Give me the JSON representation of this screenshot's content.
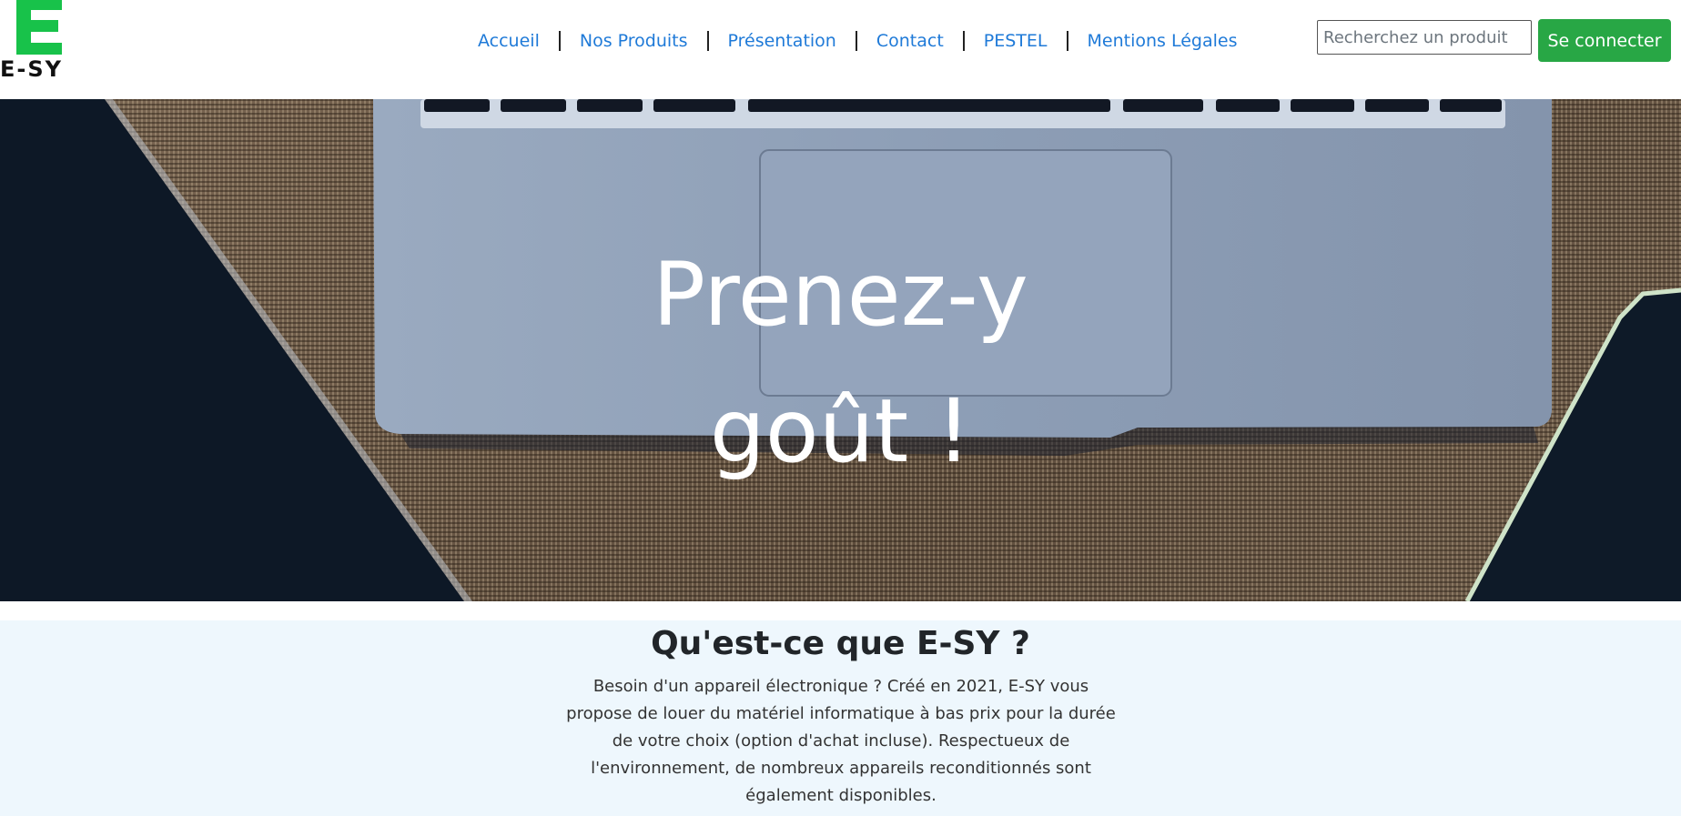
{
  "brand": {
    "logo_letter": "E",
    "logo_text": "E-SY",
    "logo_color": "#18c24a"
  },
  "nav": {
    "links": [
      {
        "label": "Accueil"
      },
      {
        "label": "Nos Produits"
      },
      {
        "label": "Présentation"
      },
      {
        "label": "Contact"
      },
      {
        "label": "PESTEL"
      },
      {
        "label": "Mentions Légales"
      }
    ],
    "link_color": "#1f7ad8"
  },
  "search": {
    "placeholder": "Recherchez un produit",
    "value": ""
  },
  "auth": {
    "login_label": "Se connecter",
    "button_color": "#28a745"
  },
  "hero": {
    "title_line1": "Prenez-y",
    "title_line2": "goût !"
  },
  "about": {
    "title": "Qu'est-ce que E-SY ?",
    "text": "Besoin d'un appareil électronique ? Créé en 2021, E-SY vous propose de louer du matériel informatique à bas prix pour la durée de votre choix (option d'achat incluse). Respectueux de l'environnement, de nombreux appareils reconditionnés sont également disponibles.",
    "background": "#eef7fd"
  }
}
